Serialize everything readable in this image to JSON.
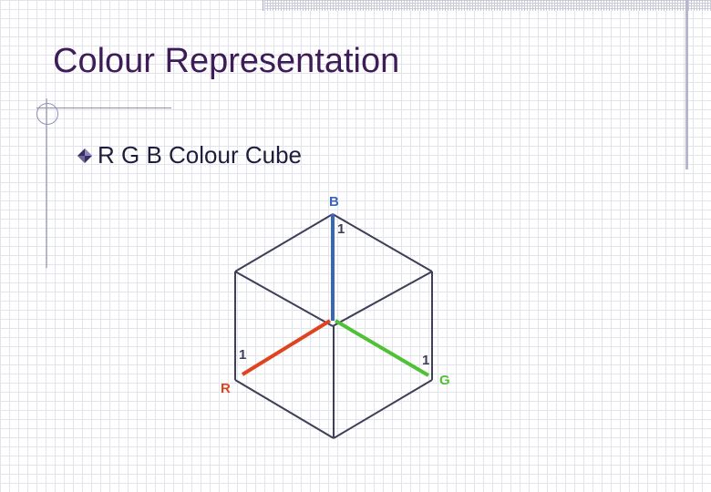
{
  "slide": {
    "title": "Colour Representation",
    "bullet": "R G B Colour Cube"
  },
  "diagram": {
    "axes": [
      {
        "name": "R",
        "tick": "1",
        "color": "#e0441f"
      },
      {
        "name": "G",
        "tick": "1",
        "color": "#4ec134"
      },
      {
        "name": "B",
        "tick": "1",
        "color": "#3a66b8"
      }
    ],
    "edge_color": "#3e3e58"
  }
}
